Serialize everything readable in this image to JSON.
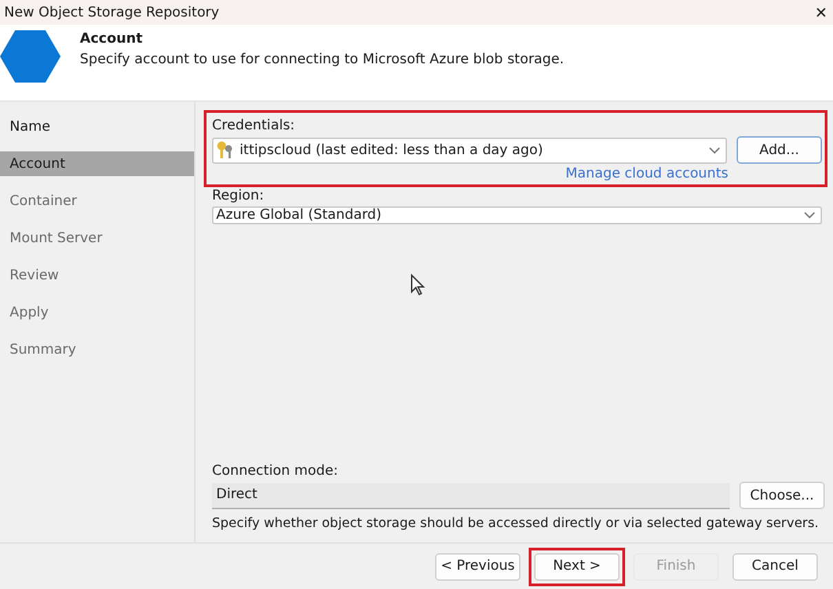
{
  "window": {
    "title": "New Object Storage Repository",
    "close": "✕"
  },
  "header": {
    "title": "Account",
    "description": "Specify account to use for connecting to Microsoft Azure blob storage."
  },
  "steps": [
    {
      "label": "Name",
      "selected": false,
      "disabled": false
    },
    {
      "label": "Account",
      "selected": true,
      "disabled": false
    },
    {
      "label": "Container",
      "selected": false,
      "disabled": true
    },
    {
      "label": "Mount Server",
      "selected": false,
      "disabled": true
    },
    {
      "label": "Review",
      "selected": false,
      "disabled": true
    },
    {
      "label": "Apply",
      "selected": false,
      "disabled": true
    },
    {
      "label": "Summary",
      "selected": false,
      "disabled": true
    }
  ],
  "credentials": {
    "label": "Credentials:",
    "value": "ittipscloud (last edited: less than a day ago)",
    "add_button": "Add...",
    "link": "Manage cloud accounts",
    "highlighted": true
  },
  "region": {
    "label": "Region:",
    "value": "Azure Global (Standard)"
  },
  "connection": {
    "label": "Connection mode:",
    "value": "Direct",
    "button": "Choose...",
    "hint": "Specify whether object storage should be accessed directly or via selected gateway servers."
  },
  "buttons": [
    {
      "label": "< Previous",
      "disabled": false,
      "highlighted": false
    },
    {
      "label": "Next >",
      "disabled": false,
      "highlighted": true
    },
    {
      "label": "Finish",
      "disabled": true,
      "highlighted": false
    },
    {
      "label": "Cancel",
      "disabled": false,
      "highlighted": false
    }
  ]
}
